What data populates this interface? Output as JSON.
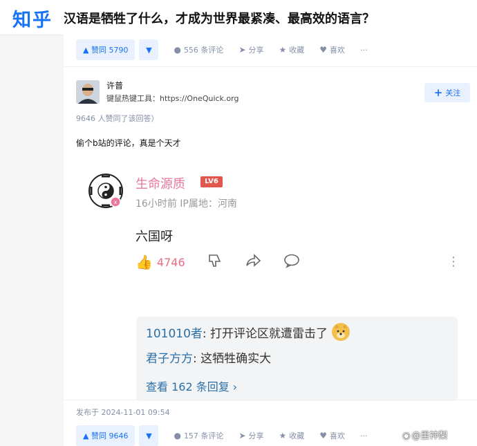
{
  "header": {
    "logo": "知乎",
    "question_title": "汉语是牺牲了什么，才成为世界最紧凑、最高效的语言？"
  },
  "top_actions": {
    "upvote_label": "▲ 赞同 5790",
    "downvote_label": "▼",
    "comments_label": "556 条评论",
    "share_label": "分享",
    "favorite_label": "收藏",
    "like_label": "喜欢",
    "more_label": "···"
  },
  "author": {
    "name": "许普",
    "bio": "键鼠热键工具：https://OneQuick.org",
    "follow_label": "关注",
    "follow_plus": "+"
  },
  "voters_text": "9646 人赞同了该回答）",
  "answer_text": "偷个b站的评论，真是个天才",
  "embedded_comment": {
    "user_name": "生命源质",
    "level_badge": "LV6",
    "meta": "16小时前  IP属地：河南",
    "content": "六国呀",
    "like_count": "4746",
    "replies": [
      {
        "name": "101010者",
        "text": ": 打开评论区就遭雷击了"
      },
      {
        "name": "君子方方",
        "text": ": 这牺牲确实大"
      }
    ],
    "view_replies": "查看 162 条回复 ›"
  },
  "publish_date": "发布于 2024-11-01 09:54",
  "bottom_actions": {
    "upvote_label": "▲ 赞同 9646",
    "downvote_label": "▼",
    "comments_label": "157 条评论",
    "share_label": "分享",
    "favorite_label": "收藏",
    "like_label": "喜欢",
    "more_label": "···"
  },
  "watermark": "@里神梨",
  "icons": {
    "comment": "comment-icon",
    "share": "share-icon",
    "favorite": "star-icon",
    "like": "heart-icon"
  },
  "colors": {
    "brand": "#1772f6",
    "bilibili_pink": "#e7789b",
    "level_badge": "#e2574c",
    "reply_name": "#2b6fa8"
  }
}
